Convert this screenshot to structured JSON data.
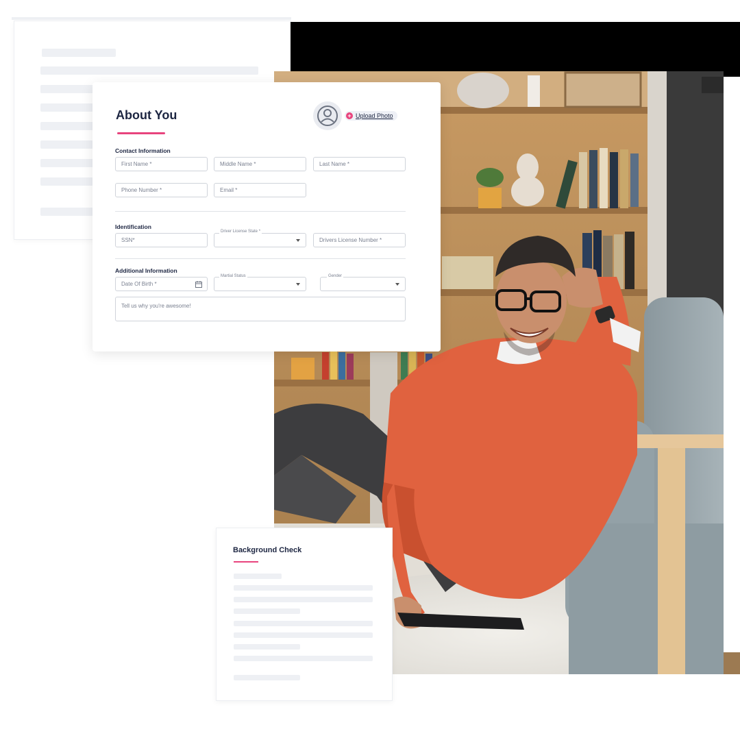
{
  "form": {
    "title": "About You",
    "upload_photo_label": "Upload Photo",
    "sections": {
      "contact": "Contact Information",
      "identification": "Identification",
      "additional": "Additional Information"
    },
    "fields": {
      "first_name": "First Name *",
      "middle_name": "Middle Name *",
      "last_name": "Last Name *",
      "phone": "Phone Number *",
      "email": "Email *",
      "ssn": "SSN*",
      "driver_license_state": "Driver License State *",
      "drivers_license_number": "Drivers License Number *",
      "date_of_birth": "Date Of Birth *",
      "martial_status": "Martial Status",
      "gender": "Gender",
      "about": "Tell us why you're awesome!"
    }
  },
  "background_check": {
    "title": "Background Check"
  },
  "colors": {
    "accent": "#e8437d",
    "heading": "#1c2541",
    "sweater": "#e0623f",
    "sofa": "#8f9ea5"
  },
  "icons": [
    "user-avatar-icon",
    "plus-icon",
    "calendar-icon",
    "chevron-down-icon"
  ]
}
